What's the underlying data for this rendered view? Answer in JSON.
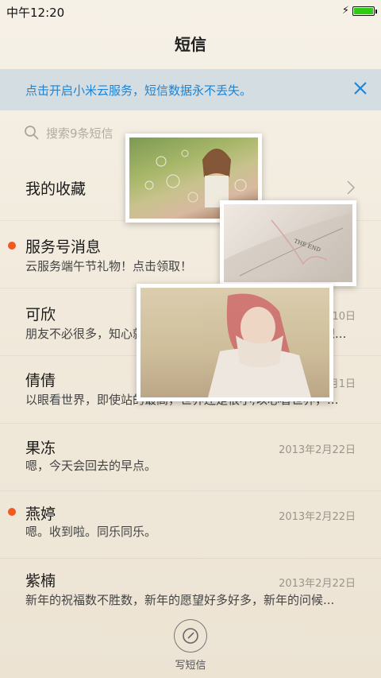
{
  "status_bar": {
    "time": "中午12:20",
    "battery_level": 1.0,
    "battery_color": "#2ecc12"
  },
  "header": {
    "title": "短信"
  },
  "banner": {
    "text": "点击开启小米云服务，短信数据永不丢失。",
    "text_color": "#1a84d8",
    "background": "#d3dde2",
    "close_icon": "close-icon"
  },
  "search": {
    "placeholder": "搜索9条短信",
    "icon": "search-icon"
  },
  "conversations": [
    {
      "name": "我的收藏",
      "preview": "",
      "date": "",
      "unread": false,
      "has_chevron": true
    },
    {
      "name": "服务号消息",
      "preview": "云服务端午节礼物！点击领取！",
      "date": "",
      "unread": true,
      "has_chevron": true
    },
    {
      "name": "可欣",
      "preview": "朋友不必很多，知心就好；牵挂不必很多，动情就好；不想...",
      "date": "2015年9月10日",
      "unread": false,
      "has_chevron": false
    },
    {
      "name": "倩倩",
      "preview": "以眼看世界，即使站的最高，世界还是很小;以心看世界，...",
      "date": "2013年3月1日",
      "unread": false,
      "has_chevron": false
    },
    {
      "name": "果冻",
      "preview": "嗯，今天会回去的早点。",
      "date": "2013年2月22日",
      "unread": false,
      "has_chevron": false
    },
    {
      "name": "燕婷",
      "preview": "嗯。收到啦。同乐同乐。",
      "date": "2013年2月22日",
      "unread": true,
      "has_chevron": false
    },
    {
      "name": "紫楠",
      "preview": "新年的祝福数不胜数，新年的愿望好多好多，新年的问候...",
      "date": "2013年2月22日",
      "unread": false,
      "has_chevron": false
    }
  ],
  "compose": {
    "label": "写短信",
    "icon": "compose-icon"
  },
  "colors": {
    "unread_dot": "#f05a22",
    "background": "#f1eadc"
  }
}
